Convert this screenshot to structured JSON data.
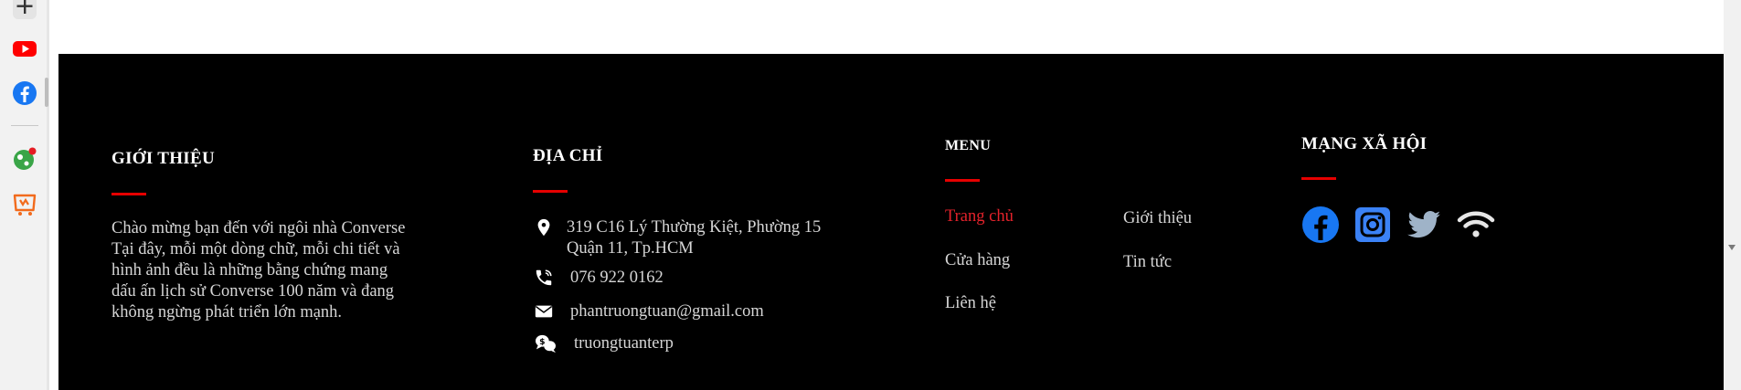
{
  "colors": {
    "footer_bg": "#000000",
    "accent": "#e60000",
    "active_link": "#e4222b",
    "text": "#d6d6d6",
    "heading": "#ffffff",
    "social_facebook": "#1877f2",
    "social_instagram": "#3b82f6",
    "social_twitter": "#9fb3c8"
  },
  "siderail": {
    "icons": [
      "add-icon",
      "youtube-icon",
      "facebook-icon",
      "game-icon",
      "shop-icon"
    ]
  },
  "footer": {
    "about": {
      "heading": "GIỚI THIỆU",
      "lines": [
        "Chào mừng bạn đến với ngôi nhà Converse",
        "Tại đây, mỗi một dòng chữ, mỗi chi tiết và",
        "hình ảnh đều là những bằng chứng mang",
        "dấu ấn lịch sử Converse 100 năm và đang",
        "không ngừng phát triển lớn mạnh."
      ]
    },
    "address": {
      "heading": "ĐỊA CHỈ",
      "location_line1": "319 C16 Lý Thường Kiệt, Phường 15",
      "location_line2": "Quận 11, Tp.HCM",
      "phone": "076 922 0162",
      "email": "phantruongtuan@gmail.com",
      "skype": "truongtuanterp",
      "icons": [
        "map-pin-icon",
        "phone-icon",
        "mail-icon",
        "chat-icon"
      ]
    },
    "menu": {
      "heading": "MENU",
      "items": [
        {
          "label": "Trang chủ",
          "active": true
        },
        {
          "label": "Giới thiệu",
          "active": false
        },
        {
          "label": "Cửa hàng",
          "active": false
        },
        {
          "label": "Tin tức",
          "active": false
        },
        {
          "label": "Liên hệ",
          "active": false
        }
      ]
    },
    "social": {
      "heading": "MẠNG XÃ HỘI",
      "icons": [
        "facebook-icon",
        "instagram-icon",
        "twitter-icon",
        "wifi-icon"
      ]
    }
  }
}
